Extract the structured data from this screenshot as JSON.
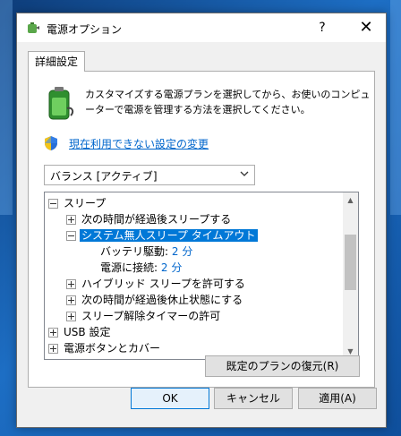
{
  "window": {
    "title": "電源オプション",
    "help_label": "?",
    "close_label": "✕"
  },
  "tab": {
    "label": "詳細設定"
  },
  "description": "カスタマイズする電源プランを選択してから、お使いのコンピューターで電源を管理する方法を選択してください。",
  "link": {
    "label": "現在利用できない設定の変更"
  },
  "plan_select": {
    "value": "バランス [アクティブ]"
  },
  "tree": {
    "sleep": "スリープ",
    "sleep_after": "次の時間が経過後スリープする",
    "unattended_timeout": "システム無人スリープ タイムアウト",
    "on_battery_label": "バッテリ駆動:",
    "on_battery_value": "2 分",
    "plugged_in_label": "電源に接続:",
    "plugged_in_value": "2 分",
    "hybrid_sleep": "ハイブリッド スリープを許可する",
    "hibernate_after": "次の時間が経過後休止状態にする",
    "wake_timers": "スリープ解除タイマーの許可",
    "usb_settings": "USB 設定",
    "power_buttons": "電源ボタンとカバー"
  },
  "buttons": {
    "restore": "既定のプランの復元(R)",
    "ok": "OK",
    "cancel": "キャンセル",
    "apply": "適用(A)"
  },
  "colors": {
    "accent": "#0078d7",
    "link": "#0066cc"
  }
}
